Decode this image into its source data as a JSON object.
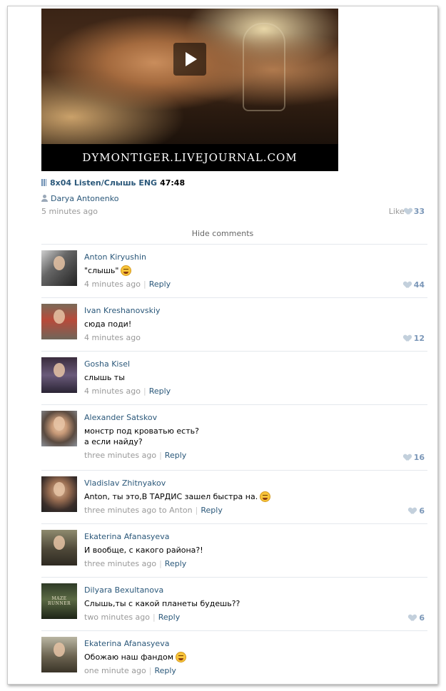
{
  "video": {
    "banner_text": "DYMONTIGER.LIVEJOURNAL.COM"
  },
  "post": {
    "audio_title": "8x04 Listen/Слышь ENG",
    "audio_duration": "47:48",
    "author": "Darya Antonenko",
    "time": "5 minutes ago",
    "like_label": "Like",
    "like_count": "33"
  },
  "hide_comments_label": "Hide comments",
  "comments": [
    {
      "name": "Anton Kiryushin",
      "lines": [
        "\"слышь\""
      ],
      "emoji": "grin",
      "time": "4 minutes ago",
      "reply": "Reply",
      "likes": "44"
    },
    {
      "name": "Ivan Kreshanovskiy",
      "lines": [
        "сюда поди!"
      ],
      "time": "4 minutes ago",
      "likes": "12"
    },
    {
      "name": "Gosha Kisel",
      "lines": [
        "слышь ты"
      ],
      "time": "4 minutes ago",
      "reply": "Reply"
    },
    {
      "name": "Alexander Satskov",
      "lines": [
        "монстр под кроватью есть?",
        "а если найду?"
      ],
      "time": "three minutes ago",
      "reply": "Reply",
      "likes": "16"
    },
    {
      "name": "Vladislav Zhitnyakov",
      "lines": [
        "Anton, ты это,В ТАРДИС зашел быстра на."
      ],
      "emoji": "laugh",
      "time": "three minutes ago",
      "to": "to Anton",
      "reply": "Reply",
      "likes": "6"
    },
    {
      "name": "Ekaterina Afanasyeva",
      "lines": [
        "И вообще, с какого района?!"
      ],
      "time": "three minutes ago",
      "reply": "Reply"
    },
    {
      "name": "Dilyara Bexultanova",
      "lines": [
        "Слышь,ты с какой планеты будешь??"
      ],
      "time": "two minutes ago",
      "reply": "Reply",
      "likes": "6",
      "avatar_text": "MAZE RUNNER"
    },
    {
      "name": "Ekaterina Afanasyeva",
      "lines": [
        "Обожаю наш фандом"
      ],
      "emoji": "grin",
      "time": "one minute ago",
      "reply": "Reply"
    }
  ]
}
